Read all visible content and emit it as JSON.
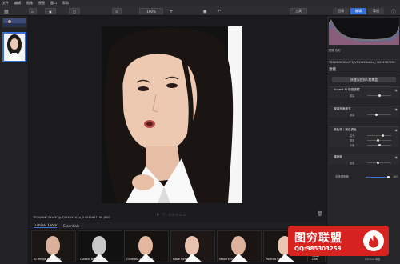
{
  "menu": [
    "文件",
    "编辑",
    "图像",
    "视图",
    "窗口",
    "帮助"
  ],
  "toolbar": {
    "zoom": "100%",
    "tools": "工具",
    "modes": [
      "目录",
      "编辑",
      "导出"
    ]
  },
  "viewer": {
    "photo_info": "TB2WHMCXXaFF1JjvTj1tXXXcAXa_!!4034967198.JPEG",
    "rating_stars": "☆☆☆☆☆",
    "counter": "1/2"
  },
  "looks": {
    "tabs": [
      "Luminar Looks",
      "Essentials"
    ],
    "items": [
      {
        "label": "AI Image Enhancer"
      },
      {
        "label": "Classic B&W"
      },
      {
        "label": "Contrast Enhancer"
      },
      {
        "label": "Haze Removal"
      },
      {
        "label": "Mood Enhancer"
      },
      {
        "label": "Portrait Enhancer"
      },
      {
        "label": "Remove Color Cast"
      }
    ]
  },
  "panel": {
    "file_label": "TB2WHMCXXaFF1JjvTj1tXXXcAXa_!!4034967198",
    "file_meta": "图像  色彩",
    "header": "滤镜",
    "quick_button": "快速添加到人脸覆盖",
    "sections": [
      {
        "title": "Accent AI 增强滤镜",
        "sliders": [
          {
            "label": "数量"
          }
        ]
      },
      {
        "title": "增强亮度细节",
        "sliders": [
          {
            "label": "数量"
          }
        ]
      },
      {
        "title": "颜色调 / 黑白调色",
        "sliders": [
          {
            "label": "高光"
          },
          {
            "label": "阴影"
          },
          {
            "label": "平衡"
          }
        ]
      },
      {
        "title": "清晰度",
        "sliders": [
          {
            "label": "数量"
          }
        ]
      }
    ],
    "opacity_label": "总体透明度",
    "opacity_value": "100"
  },
  "watermark": {
    "title": "图穷联盟",
    "qq": "QQ:985303259"
  },
  "footer": "Luminar 联盟"
}
